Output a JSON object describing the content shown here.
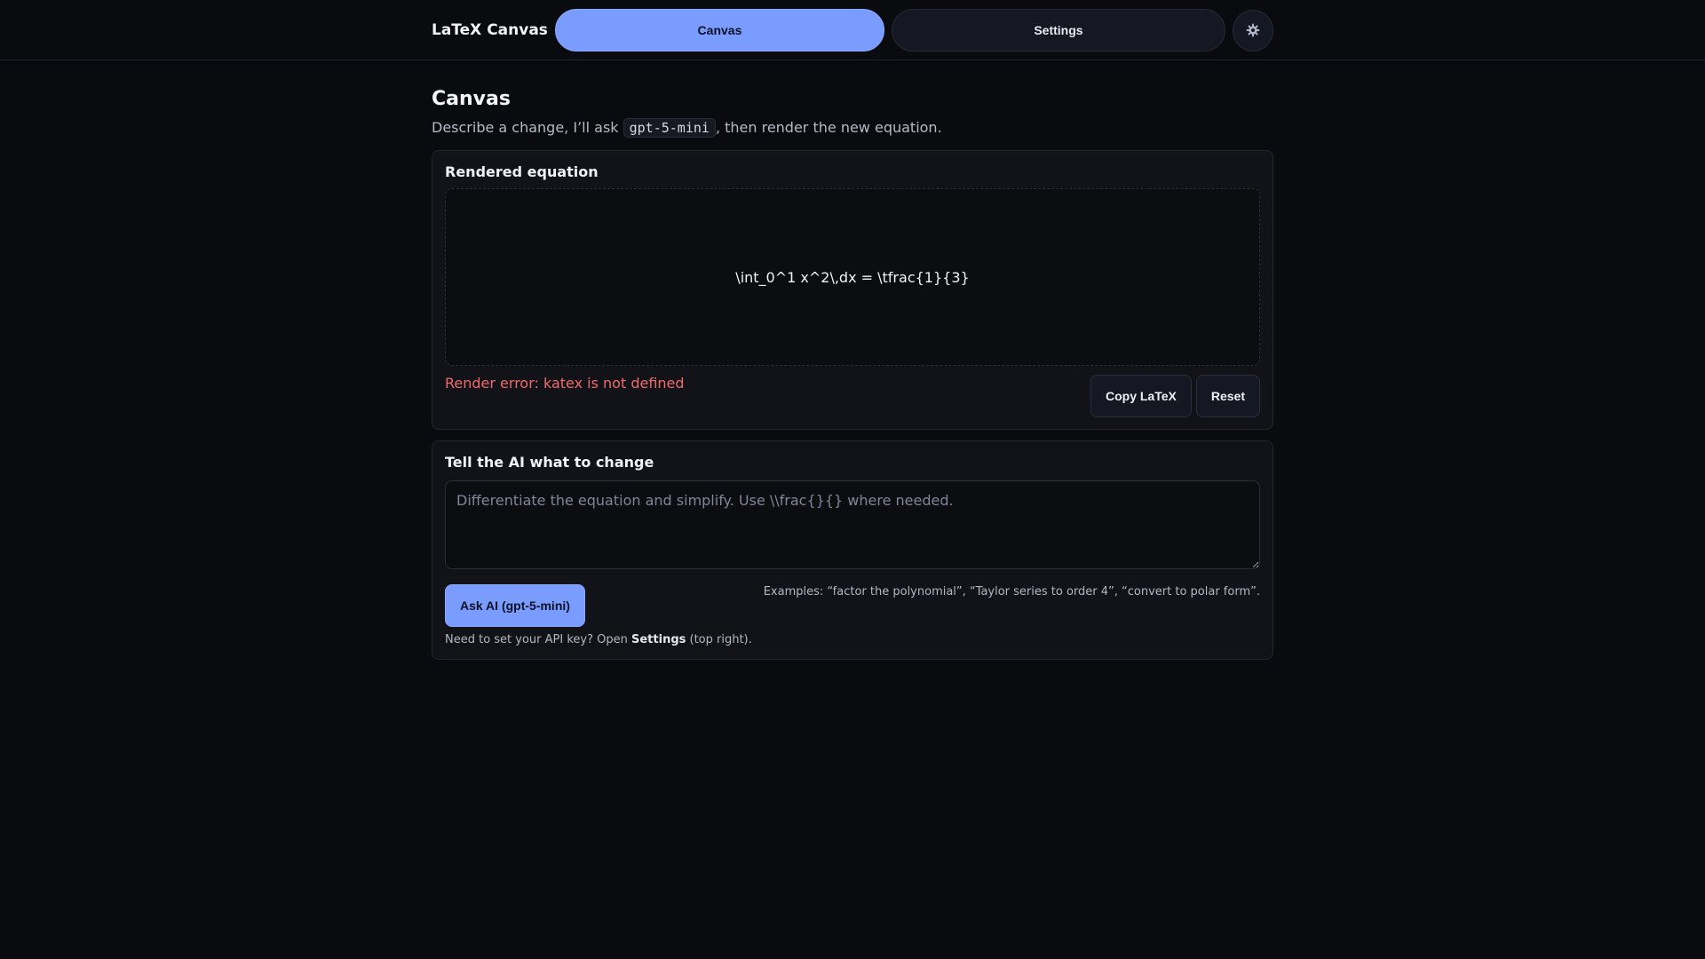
{
  "header": {
    "brand": "LaTeX Canvas",
    "tabs": [
      {
        "label": "Canvas",
        "active": true
      },
      {
        "label": "Settings",
        "active": false
      }
    ],
    "gear_icon": "gear-icon"
  },
  "page": {
    "title": "Canvas",
    "subtitle_before": "Describe a change, I’ll ask ",
    "model_code": "gpt-5-mini",
    "subtitle_after": ", then render the new equation."
  },
  "rendered_card": {
    "title": "Rendered equation",
    "equation": "\\int_0^1 x^2\\,dx = \\tfrac{1}{3}",
    "error": "Render error: katex is not defined",
    "copy_label": "Copy LaTeX",
    "reset_label": "Reset"
  },
  "ai_card": {
    "title": "Tell the AI what to change",
    "input_value": "",
    "input_placeholder": "Differentiate the equation and simplify. Use \\\\frac{}{} where needed.",
    "ask_label": "Ask AI (gpt-5-mini)",
    "examples": "Examples: “factor the polynomial”, “Taylor series to order 4”, “convert to polar form”.",
    "hint_before": "Need to set your API key? Open ",
    "hint_bold": "Settings",
    "hint_after": " (top right)."
  },
  "colors": {
    "accent": "#7b9cff",
    "background": "#0a0b0e",
    "error": "#f06a6a"
  }
}
